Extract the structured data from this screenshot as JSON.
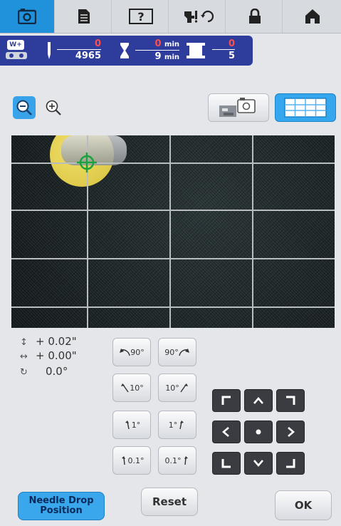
{
  "tabs": [
    {
      "name": "camera-icon",
      "active": true
    },
    {
      "name": "document-icon",
      "active": false
    },
    {
      "name": "help-icon",
      "active": false
    },
    {
      "name": "settings-icon",
      "active": false
    },
    {
      "name": "lock-icon",
      "active": false
    },
    {
      "name": "home-icon",
      "active": false
    }
  ],
  "help_label": "?",
  "status": {
    "stitch_current": "0",
    "stitch_total": "4965",
    "time_current": "0",
    "time_total": "9",
    "time_unit": "min",
    "color_current": "0",
    "color_total": "5",
    "badge_label": "W+"
  },
  "readouts": {
    "vertical": "+ 0.02\"",
    "horizontal": "+ 0.00\"",
    "rotation": "0.0°"
  },
  "rotate_buttons": {
    "ccw90": "90°",
    "cw90": "90°",
    "ccw10": "10°",
    "cw10": "10°",
    "ccw1": "1°",
    "cw1": "1°",
    "ccw01": "0.1°",
    "cw01": "0.1°"
  },
  "buttons": {
    "needle_drop_line1": "Needle Drop",
    "needle_drop_line2": "Position",
    "reset": "Reset",
    "ok": "OK"
  },
  "colors": {
    "accent": "#1f92db",
    "status_bar": "#2e3d9c",
    "counter_red": "#ff4d4d",
    "arrow_pad": "#3a3c42"
  }
}
